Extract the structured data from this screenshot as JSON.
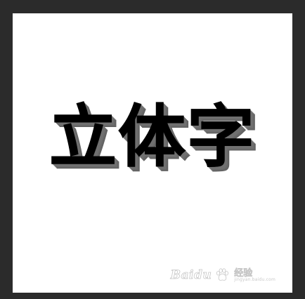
{
  "canvas": {
    "text": "立体字",
    "background_color": "#ffffff",
    "text_color": "#000000",
    "shadow_color": "#707070"
  },
  "watermark": {
    "icon": "paw-icon",
    "brand": "Baidu",
    "cn": "经验",
    "url": "jingyan.baidu.com"
  }
}
